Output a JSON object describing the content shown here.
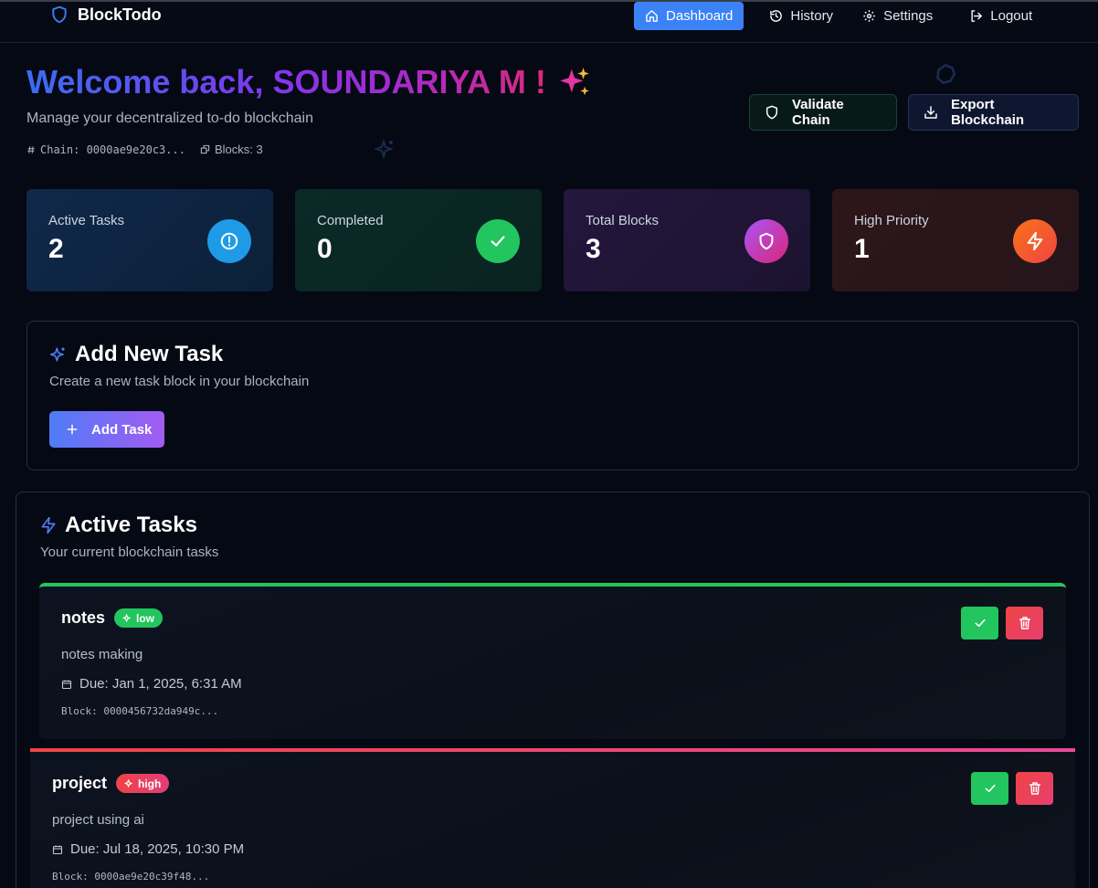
{
  "brand": {
    "name": "BlockTodo",
    "icon": "shield-icon"
  },
  "nav": [
    {
      "label": "Dashboard",
      "icon": "home-icon",
      "active": true
    },
    {
      "label": "History",
      "icon": "history-icon",
      "active": false
    },
    {
      "label": "Settings",
      "icon": "gear-icon",
      "active": false
    },
    {
      "label": "Logout",
      "icon": "logout-icon",
      "active": false
    }
  ],
  "header": {
    "welcome_prefix": "Welcome back, ",
    "username": "SOUNDARIYA M !",
    "emoji": "✨",
    "subtitle": "Manage your decentralized to-do blockchain",
    "chain_label": "Chain: 0000ae9e20c3...",
    "blocks_label": "Blocks: 3",
    "validate_label": "Validate Chain",
    "export_label": "Export Blockchain"
  },
  "stats": [
    {
      "label": "Active Tasks",
      "value": "2",
      "icon": "alert-circle-icon",
      "color": "#1e9be6"
    },
    {
      "label": "Completed",
      "value": "0",
      "icon": "check-icon",
      "color": "#22c55e"
    },
    {
      "label": "Total Blocks",
      "value": "3",
      "icon": "shield-icon",
      "color": "#c04fd6"
    },
    {
      "label": "High Priority",
      "value": "1",
      "icon": "zap-icon",
      "color": "#f0522b"
    }
  ],
  "add_task": {
    "title": "Add New Task",
    "subtitle": "Create a new task block in your blockchain",
    "button_label": "Add Task"
  },
  "active_tasks": {
    "title": "Active Tasks",
    "subtitle": "Your current blockchain tasks",
    "items": [
      {
        "name": "notes",
        "priority": "low",
        "description": "notes making",
        "due": "Due: Jan 1, 2025, 6:31 AM",
        "block": "Block: 0000456732da949c..."
      },
      {
        "name": "project",
        "priority": "high",
        "description": "project using ai",
        "due": "Due: Jul 18, 2025, 10:30 PM",
        "block": "Block: 0000ae9e20c39f48..."
      }
    ]
  },
  "colors": {
    "background": "#050914",
    "accent_blue": "#3b82f6",
    "success": "#22c55e",
    "danger": "#ef4444"
  }
}
